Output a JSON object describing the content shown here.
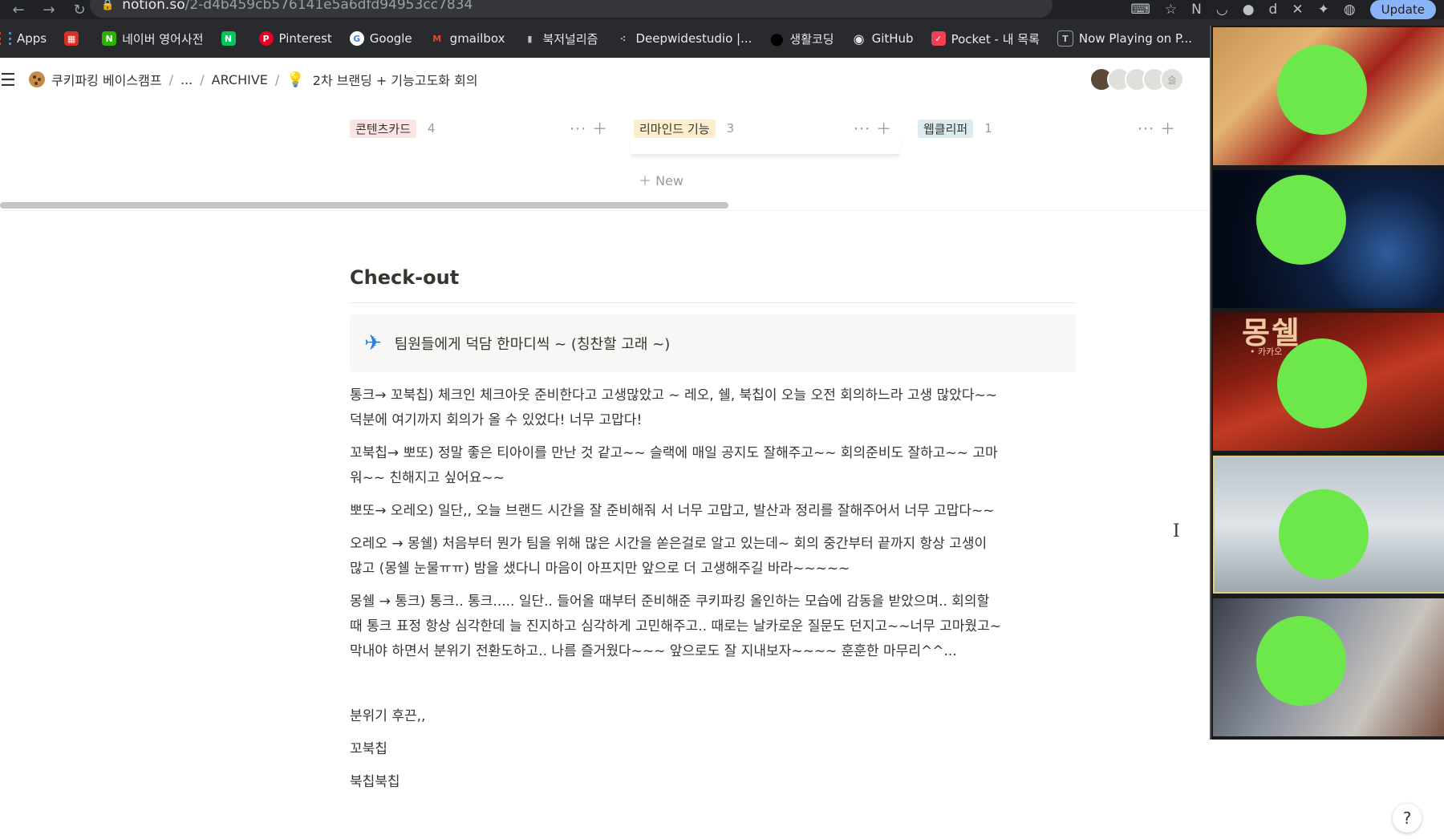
{
  "browser": {
    "url_host": "notion.so",
    "url_path": "/2-d4b459cb576141e5a6dfd94953cc7834",
    "update_label": "Update",
    "bookmarks": [
      {
        "label": "Apps",
        "color": "#4285f4",
        "glyph": ""
      },
      {
        "label": "",
        "color": "#d93025",
        "glyph": "▦"
      },
      {
        "label": "네이버 영어사전",
        "color": "#2db400",
        "glyph": "N"
      },
      {
        "label": "",
        "color": "#03c75a",
        "glyph": "N"
      },
      {
        "label": "Pinterest",
        "color": "#e60023",
        "glyph": "P"
      },
      {
        "label": "Google",
        "color": "#ffffff",
        "glyph": "G"
      },
      {
        "label": "gmailbox",
        "color": "#ea4335",
        "glyph": "M"
      },
      {
        "label": "북저널리즘",
        "color": "#292a2d",
        "glyph": "▮"
      },
      {
        "label": "Deepwidestudio |...",
        "color": "#292a2d",
        "glyph": "⁖"
      },
      {
        "label": "생활코딩",
        "color": "#000000",
        "glyph": "●"
      },
      {
        "label": "GitHub",
        "color": "#292a2d",
        "glyph": "◉"
      },
      {
        "label": "Pocket - 내 목록",
        "color": "#ef4056",
        "glyph": "✓"
      },
      {
        "label": "Now Playing on P...",
        "color": "#292a2d",
        "glyph": "T"
      }
    ]
  },
  "topbar": {
    "breadcrumb": [
      "쿠키파킹 베이스캠프",
      "...",
      "ARCHIVE",
      "2차 브랜딩 + 기능고도화 회의"
    ],
    "avatar_initial": "슬"
  },
  "board": {
    "columns": [
      {
        "name": "콘텐츠카드",
        "count": "4",
        "color": "#fbe4e4"
      },
      {
        "name": "리마인드 기능",
        "count": "3",
        "color": "#fbeecc"
      },
      {
        "name": "웹클리퍼",
        "count": "1",
        "color": "#ddebf1"
      }
    ],
    "new_label": "New"
  },
  "content": {
    "heading": "Check-out",
    "callout_text": "팀원들에게 덕담 한마디씩 ~ (칭찬할 고래 ~)",
    "paragraphs": [
      [
        "통크→ 꼬북칩) 체크인 체크아웃 준비한다고 고생많았고 ~ 레오, 쉘, 북칩이 오늘 오전 회의하느라 고생 많았다~~",
        "덕분에 여기까지 회의가 올 수 있었다! 너무 고맙다!"
      ],
      [
        "꼬북칩→ 뽀또) 정말 좋은 티아이를 만난 것 같고~~ 슬랙에 매일 공지도 잘해주고~~ 회의준비도 잘하고~~ 고마",
        "워~~ 친해지고 싶어요~~"
      ],
      [
        "뽀또→ 오레오) 일단,, 오늘 브랜드 시간을 잘 준비해줘 서 너무 고맙고, 발산과 정리를 잘해주어서 너무 고맙다~~"
      ],
      [
        "오레오 → 몽쉘) 처음부터 뭔가 팀을 위해 많은 시간을 쏟은걸로 알고 있는데~ 회의 중간부터 끝까지 항상 고생이",
        "많고 (몽쉘 눈물ㅠㅠ) 밤을 샜다니 마음이 아프지만 앞으로 더 고생해주길 바라~~~~~"
      ],
      [
        "몽쉘 → 통크) 통크.. 통크..... 일단.. 들어올 때부터 준비해준 쿠키파킹 올인하는 모습에 감동을 받았으며.. 회의할",
        "때 통크 표정 항상 심각한데 늘 진지하고 심각하게 고민해주고.. 때로는 날카로운 질문도 던지고~~너무 고마웠고~",
        "막내야 하면서 분위기 전환도하고.. 나름 즐거웠다~~~ 앞으로도 잘 지내보자~~~~ 훈훈한 마무리^^..."
      ]
    ],
    "footer_lines": [
      "분위기 후끈,,",
      "꼬북칩",
      "북칩북칩"
    ]
  },
  "video": {
    "tile2_brand": "몽쉘",
    "tile2_sub": "• 카카오"
  },
  "help_label": "?"
}
